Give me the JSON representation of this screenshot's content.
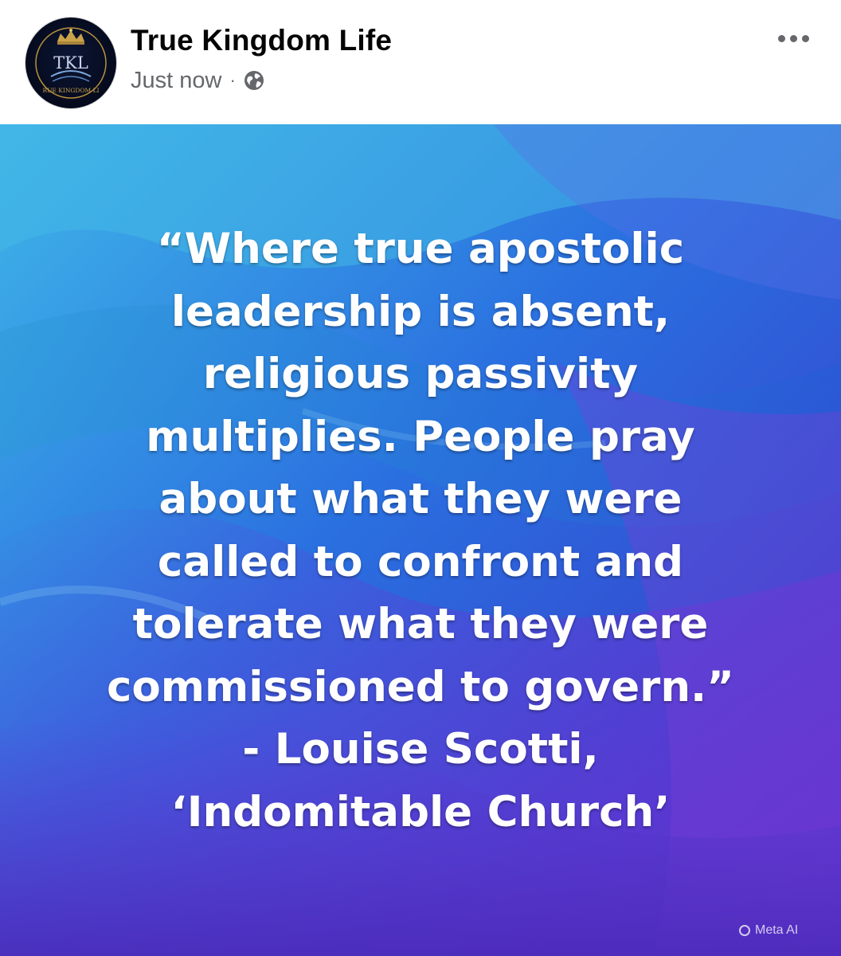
{
  "post": {
    "page_name": "True Kingdom Life",
    "timestamp": "Just now",
    "separator": "·",
    "audience_icon": "globe-icon",
    "more_icon": "more-options-icon",
    "avatar": {
      "monogram": "TKL",
      "ring_text": "RUE KINGDOM LI",
      "icon": "crown-logo"
    }
  },
  "image": {
    "quote_lines": [
      "“Where true apostolic",
      "leadership is absent,",
      "religious passivity",
      "multiplies. People pray",
      "about what they were",
      "called to confront and",
      "tolerate what they were",
      "commissioned to govern.”",
      "- Louise Scotti,",
      "‘Indomitable Church’"
    ],
    "watermark": "Meta AI"
  },
  "colors": {
    "page_name": "#050505",
    "meta_text": "#65676b",
    "quote_text": "#ffffff",
    "bg_blue": "#2a8fd6",
    "bg_purple": "#4a2fc8"
  }
}
